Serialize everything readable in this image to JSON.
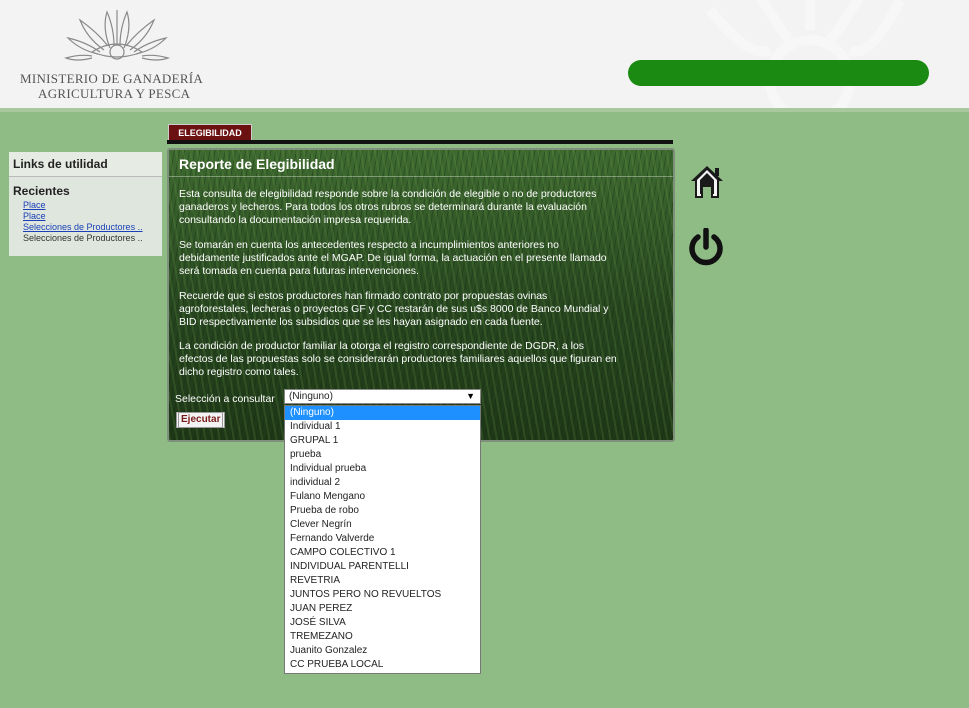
{
  "header": {
    "ministry_line1": "MINISTERIO DE GANADERÍA",
    "ministry_line2": "AGRICULTURA Y PESCA"
  },
  "sidebar": {
    "links_title": "Links de utilidad",
    "recent_title": "Recientes",
    "recent_items": [
      "Place",
      "Place",
      "Selecciones de Productores ..",
      "Selecciones de Productores .."
    ]
  },
  "tab": {
    "label": "ELEGIBILIDAD"
  },
  "report": {
    "title": "Reporte de Elegibilidad",
    "paragraphs": [
      "Esta consulta de elegibilidad responde sobre la condición de elegible o no de productores ganaderos y lecheros. Para todos los otros rubros se determinará durante la evaluación consultando la documentación impresa requerida.",
      "Se tomarán en cuenta los antecedentes respecto a incumplimientos anteriores no debidamente justificados ante el MGAP. De igual forma, la actuación en el presente llamado será tomada en cuenta para futuras intervenciones.",
      "Recuerde que si estos productores han firmado contrato por propuestas ovinas agroforestales, lecheras o proyectos GF y CC restarán de sus u$s 8000 de Banco Mundial y BID respectivamente los subsidios que se les hayan asignado en cada fuente.",
      "La condición de productor familiar la otorga el registro correspondiente de DGDR, a los efectos de las propuestas solo se considerarán productores familiares aquellos que figuran en dicho registro como tales."
    ],
    "selection_label": "Selección a consultar",
    "selected_value": "(Ninguno)",
    "execute_label": "Ejecutar"
  },
  "dropdown_options": [
    "(Ninguno)",
    "Individual 1",
    "GRUPAL 1",
    "prueba",
    "Individual prueba",
    "individual 2",
    "Fulano Mengano",
    "Prueba de robo",
    "Clever Negrín",
    "Fernando Valverde",
    "CAMPO COLECTIVO 1",
    "INDIVIDUAL PARENTELLI",
    "REVETRIA",
    "JUNTOS PERO NO REVUELTOS",
    "JUAN PEREZ",
    "JOSÉ SILVA",
    "TREMEZANO",
    "Juanito Gonzalez",
    "CC PRUEBA LOCAL"
  ],
  "icons": {
    "home": "home-icon",
    "power": "power-icon"
  },
  "colors": {
    "header_bar": "#1a8a12",
    "tab_bg": "#6b1111",
    "page_bg": "#8fbb85"
  }
}
